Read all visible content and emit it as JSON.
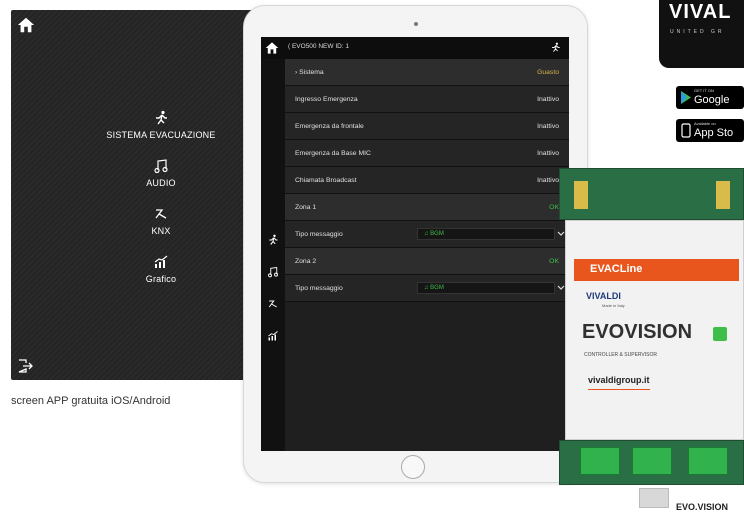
{
  "left_app": {
    "menu": [
      {
        "label": "SISTEMA EVACUAZIONE",
        "icon": "running-man-icon"
      },
      {
        "label": "AUDIO",
        "icon": "music-note-icon"
      },
      {
        "label": "KNX",
        "icon": "knx-icon"
      },
      {
        "label": "Grafico",
        "icon": "chart-icon"
      }
    ],
    "caption": "screen APP gratuita iOS/Android"
  },
  "tablet_app": {
    "header_title": "( EVO500 NEW ID: 1",
    "rows": [
      {
        "label": "› Sistema",
        "value": "Guasto",
        "status": "warn"
      },
      {
        "label": "Ingresso Emergenza",
        "value": "Inattivo",
        "status": "normal"
      },
      {
        "label": "Emergenza da frontale",
        "value": "Inattivo",
        "status": "normal"
      },
      {
        "label": "Emergenza da Base MIC",
        "value": "Inattivo",
        "status": "normal"
      },
      {
        "label": "Chiamata Broadcast",
        "value": "Inattivo",
        "status": "normal"
      },
      {
        "label": "Zona 1",
        "value": "OK",
        "status": "ok"
      },
      {
        "label": "Tipo messaggio",
        "value": "♫ BGM",
        "status": "select"
      },
      {
        "label": "Zona 2",
        "value": "OK",
        "status": "ok"
      },
      {
        "label": "Tipo messaggio",
        "value": "♫ BGM",
        "status": "select"
      }
    ]
  },
  "brand": {
    "logo_big": "VIVAL",
    "logo_small": "UNITED GR"
  },
  "stores": {
    "google_tiny": "GET IT ON",
    "google_name": "Google",
    "apple_tiny": "Available on",
    "apple_name": "App Sto"
  },
  "device": {
    "band": "EVACLine",
    "vivaldi": "VIVALDI",
    "made": "Made in Italy",
    "evo": "EVOVISION",
    "ctrl": "CONTROLLER & SUPERVISOR",
    "url": "vivaldigroup.it",
    "label": "EVO.VISION"
  },
  "colors": {
    "ok": "#3fbf49",
    "warn": "#d8b24a",
    "accent": "#e8561d"
  }
}
